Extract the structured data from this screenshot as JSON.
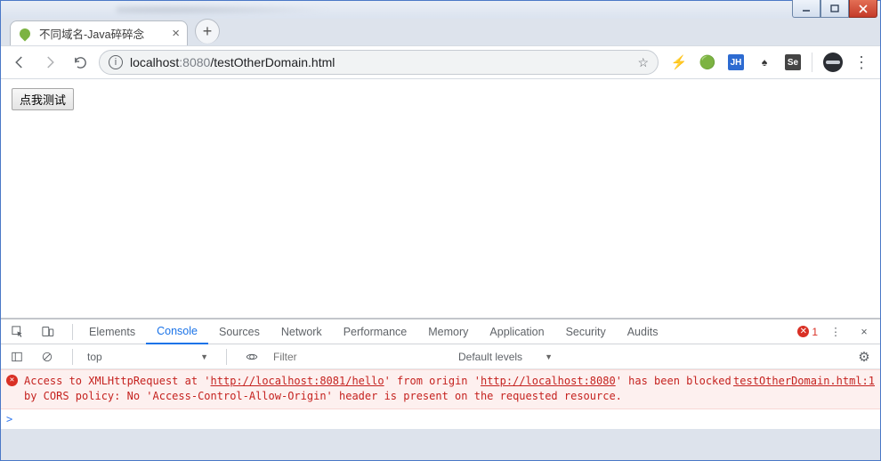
{
  "window": {
    "min_tip": "Minimize",
    "max_tip": "Maximize",
    "close_tip": "Close"
  },
  "tab": {
    "title": "不同域名-Java碎碎念",
    "favicon": "spring-leaf-icon"
  },
  "nav": {
    "back": "Back",
    "forward": "Forward",
    "reload": "Reload"
  },
  "omnibox": {
    "scheme_info": "i",
    "host": "localhost",
    "port": ":8080",
    "path": "/testOtherDomain.html",
    "star": "☆"
  },
  "extensions": [
    {
      "name": "ext-lightning",
      "glyph": "⚡",
      "color": "#f5a623"
    },
    {
      "name": "ext-globe",
      "glyph": "🌐",
      "color": "#2aa7a0"
    },
    {
      "name": "ext-jh",
      "glyph": "JH",
      "color": "#fff",
      "bg": "#2d6bd1"
    },
    {
      "name": "ext-tree",
      "glyph": "♣",
      "color": "#333"
    },
    {
      "name": "ext-selenium",
      "glyph": "Se",
      "color": "#fff",
      "bg": "#444"
    }
  ],
  "page": {
    "test_button": "点我测试"
  },
  "devtools": {
    "tabs": {
      "elements": "Elements",
      "console": "Console",
      "sources": "Sources",
      "network": "Network",
      "performance": "Performance",
      "memory": "Memory",
      "application": "Application",
      "security": "Security",
      "audits": "Audits"
    },
    "error_count": "1",
    "context": "top",
    "filter_placeholder": "Filter",
    "levels": "Default levels",
    "console_error": {
      "prefix": "Access to XMLHttpRequest at '",
      "url1": "http://localhost:8081/hello",
      "mid1": "' from origin '",
      "url2": "http://localhost:8080",
      "mid2": "' has been blocked by CORS policy: No 'Access-Control-Allow-Origin' header is present on the requested resource.",
      "source": "testOtherDomain.html:1"
    },
    "prompt": ">"
  }
}
